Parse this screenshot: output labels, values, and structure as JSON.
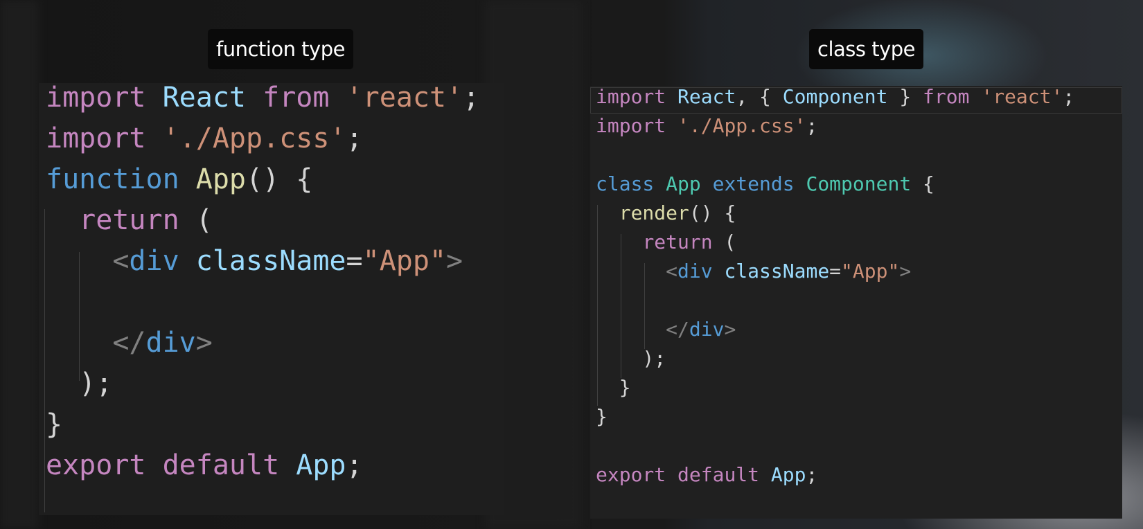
{
  "captions": {
    "left": "function type",
    "right": "class type"
  },
  "function_code": {
    "lines": [
      [
        [
          "keyword",
          "import"
        ],
        [
          "punct",
          " "
        ],
        [
          "ident",
          "React"
        ],
        [
          "punct",
          " "
        ],
        [
          "keyword",
          "from"
        ],
        [
          "punct",
          " "
        ],
        [
          "string",
          "'react'"
        ],
        [
          "punct",
          ";"
        ]
      ],
      [
        [
          "keyword",
          "import"
        ],
        [
          "punct",
          " "
        ],
        [
          "string",
          "'./App.css'"
        ],
        [
          "punct",
          ";"
        ]
      ],
      [
        [
          "storage",
          "function"
        ],
        [
          "punct",
          " "
        ],
        [
          "func",
          "App"
        ],
        [
          "punct",
          "() {"
        ]
      ],
      [
        [
          "punct",
          "  "
        ],
        [
          "keyword",
          "return"
        ],
        [
          "punct",
          " ("
        ]
      ],
      [
        [
          "punct",
          "    "
        ],
        [
          "tagpunct",
          "<"
        ],
        [
          "tag",
          "div"
        ],
        [
          "punct",
          " "
        ],
        [
          "attr",
          "className"
        ],
        [
          "punct",
          "="
        ],
        [
          "string",
          "\"App\""
        ],
        [
          "tagpunct",
          ">"
        ]
      ],
      [],
      [
        [
          "punct",
          "    "
        ],
        [
          "tagpunct",
          "</"
        ],
        [
          "tag",
          "div"
        ],
        [
          "tagpunct",
          ">"
        ]
      ],
      [
        [
          "punct",
          "  );"
        ]
      ],
      [
        [
          "punct",
          "}"
        ]
      ],
      [
        [
          "keyword",
          "export"
        ],
        [
          "punct",
          " "
        ],
        [
          "keyword",
          "default"
        ],
        [
          "punct",
          " "
        ],
        [
          "ident",
          "App"
        ],
        [
          "punct",
          ";"
        ]
      ]
    ]
  },
  "class_code": {
    "lines": [
      [
        [
          "keyword",
          "import"
        ],
        [
          "punct",
          " "
        ],
        [
          "ident",
          "React"
        ],
        [
          "punct",
          ", { "
        ],
        [
          "ident",
          "Component"
        ],
        [
          "punct",
          " } "
        ],
        [
          "keyword",
          "from"
        ],
        [
          "punct",
          " "
        ],
        [
          "string",
          "'react'"
        ],
        [
          "punct",
          ";"
        ]
      ],
      [
        [
          "keyword",
          "import"
        ],
        [
          "punct",
          " "
        ],
        [
          "string",
          "'./App.css'"
        ],
        [
          "punct",
          ";"
        ]
      ],
      [],
      [
        [
          "storage",
          "class"
        ],
        [
          "punct",
          " "
        ],
        [
          "type",
          "App"
        ],
        [
          "punct",
          " "
        ],
        [
          "storage",
          "extends"
        ],
        [
          "punct",
          " "
        ],
        [
          "type",
          "Component"
        ],
        [
          "punct",
          " {"
        ]
      ],
      [
        [
          "punct",
          "  "
        ],
        [
          "func",
          "render"
        ],
        [
          "punct",
          "() {"
        ]
      ],
      [
        [
          "punct",
          "    "
        ],
        [
          "keyword",
          "return"
        ],
        [
          "punct",
          " ("
        ]
      ],
      [
        [
          "punct",
          "      "
        ],
        [
          "tagpunct",
          "<"
        ],
        [
          "tag",
          "div"
        ],
        [
          "punct",
          " "
        ],
        [
          "attr",
          "className"
        ],
        [
          "punct",
          "="
        ],
        [
          "string",
          "\"App\""
        ],
        [
          "tagpunct",
          ">"
        ]
      ],
      [],
      [
        [
          "punct",
          "      "
        ],
        [
          "tagpunct",
          "</"
        ],
        [
          "tag",
          "div"
        ],
        [
          "tagpunct",
          ">"
        ]
      ],
      [
        [
          "punct",
          "    );"
        ]
      ],
      [
        [
          "punct",
          "  }"
        ]
      ],
      [
        [
          "punct",
          "}"
        ]
      ],
      [],
      [
        [
          "keyword",
          "export"
        ],
        [
          "punct",
          " "
        ],
        [
          "keyword",
          "default"
        ],
        [
          "punct",
          " "
        ],
        [
          "ident",
          "App"
        ],
        [
          "punct",
          ";"
        ]
      ]
    ]
  }
}
